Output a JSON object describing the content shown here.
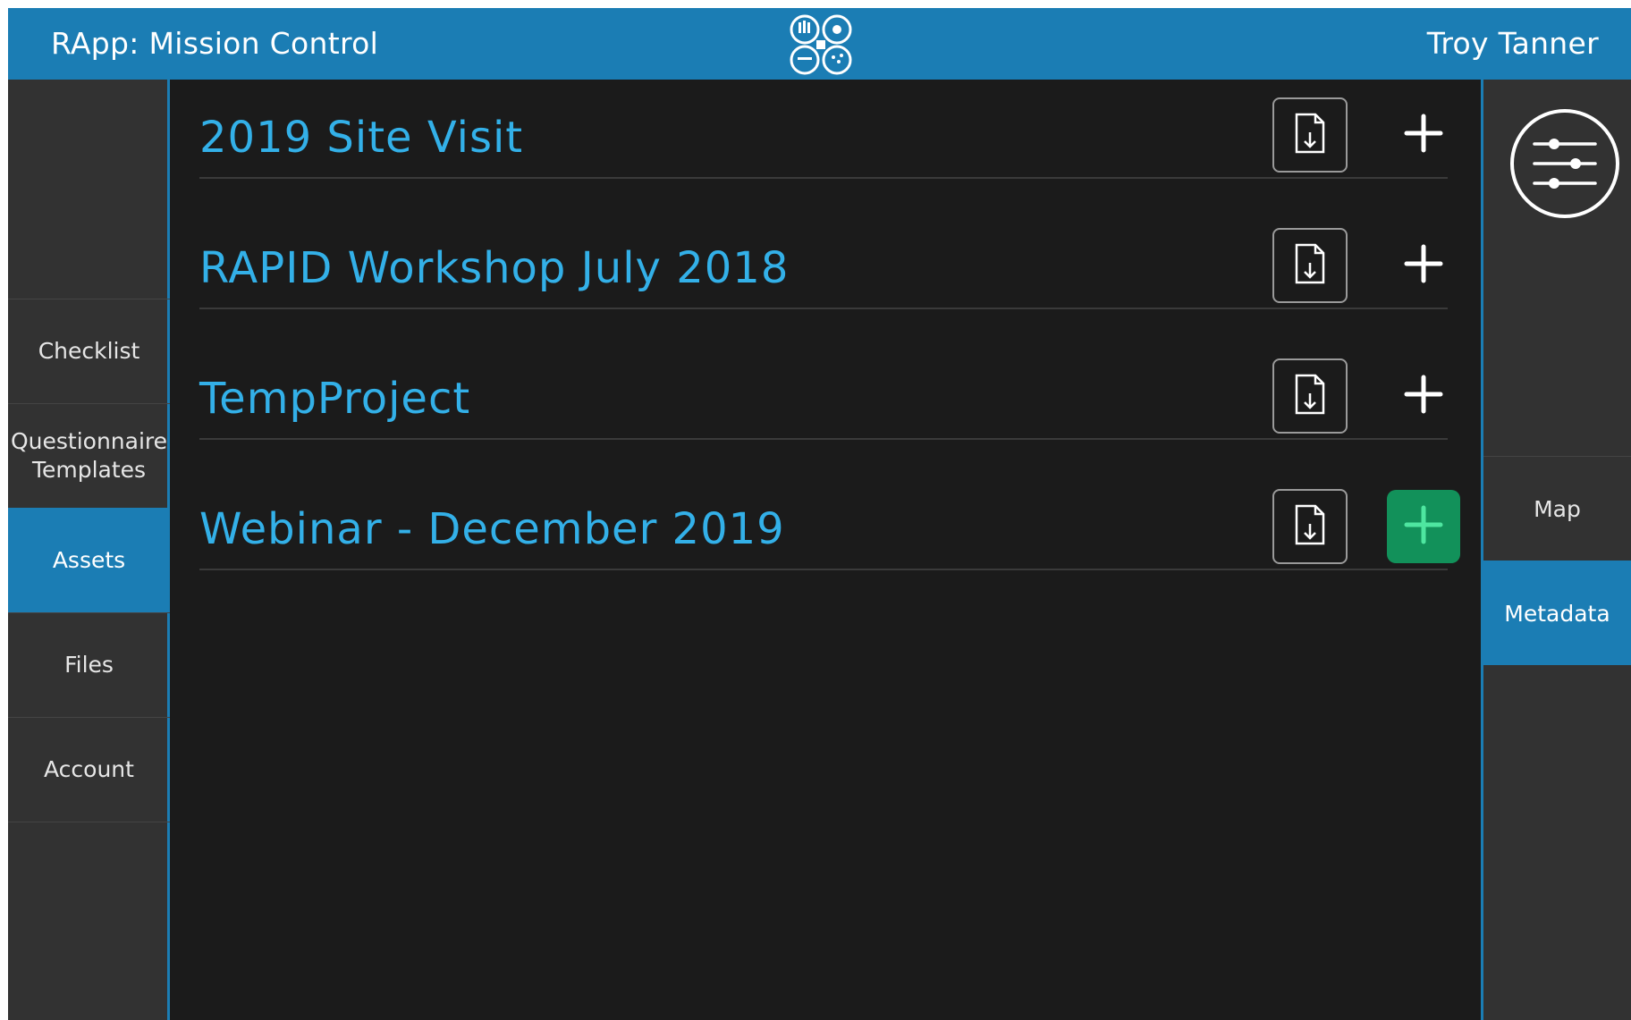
{
  "header": {
    "app_title": "RApp: Mission Control",
    "user_name": "Troy Tanner",
    "logo_icon": "rapid-logo-icon"
  },
  "sidebar_left": {
    "items": [
      {
        "label": "Checklist",
        "active": false
      },
      {
        "label": "Questionnaire\nTemplates",
        "active": false
      },
      {
        "label": "Assets",
        "active": true
      },
      {
        "label": "Files",
        "active": false
      },
      {
        "label": "Account",
        "active": false
      }
    ]
  },
  "projects": [
    {
      "name": "2019 Site Visit",
      "add_highlighted": false
    },
    {
      "name": "RAPID Workshop July 2018",
      "add_highlighted": false
    },
    {
      "name": "TempProject",
      "add_highlighted": false
    },
    {
      "name": "Webinar - December 2019",
      "add_highlighted": true
    }
  ],
  "sidebar_right": {
    "filter_icon": "sliders-icon",
    "items": [
      {
        "label": "Map",
        "active": false
      },
      {
        "label": "Metadata",
        "active": true
      }
    ]
  },
  "colors": {
    "header_blue": "#1b7db4",
    "title_blue": "#33b0e8",
    "add_green": "#12915a",
    "background": "#1b1b1b",
    "sidebar": "#323232"
  }
}
